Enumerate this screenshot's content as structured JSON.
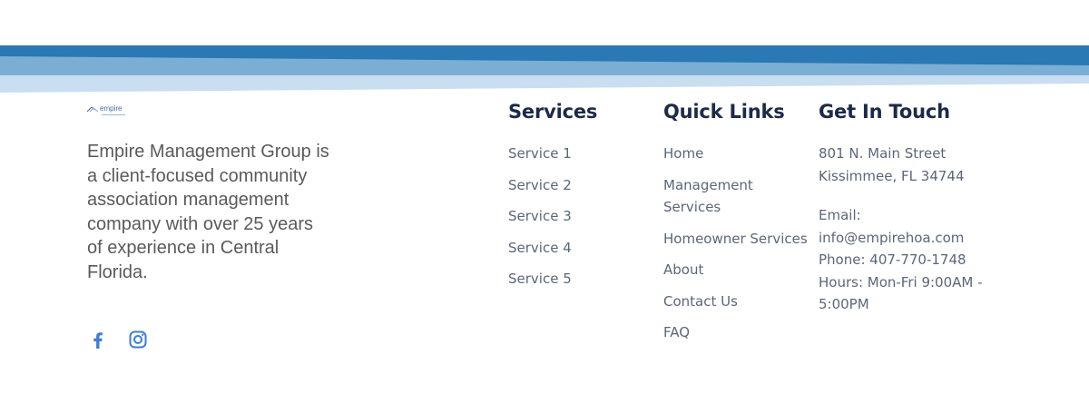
{
  "colors": {
    "band_dark": "#2a78b4",
    "band_mid": "#7aaed4",
    "band_light": "#c9def0",
    "heading": "#1c2a4a",
    "link": "#5c667a",
    "social": "#3b7dd8"
  },
  "brand": {
    "logo_text": "empire",
    "description": "Empire Management Group is a client-focused community association management company with over 25 years of experience in Central Florida."
  },
  "social": [
    {
      "icon": "facebook-icon"
    },
    {
      "icon": "instagram-icon"
    }
  ],
  "services": {
    "heading": "Services",
    "items": [
      "Service 1",
      "Service 2",
      "Service 3",
      "Service 4",
      "Service 5"
    ]
  },
  "quick_links": {
    "heading": "Quick Links",
    "items": [
      "Home",
      "Management Services",
      "Homeowner Services",
      "About",
      "Contact Us",
      "FAQ"
    ]
  },
  "contact": {
    "heading": "Get In Touch",
    "address_line1": "801 N. Main Street",
    "address_line2": "Kissimmee, FL 34744",
    "email_label": "Email:",
    "email": "info@empirehoa.com",
    "phone": "Phone: 407-770-1748",
    "hours": "Hours: Mon-Fri 9:00AM - 5:00PM"
  }
}
